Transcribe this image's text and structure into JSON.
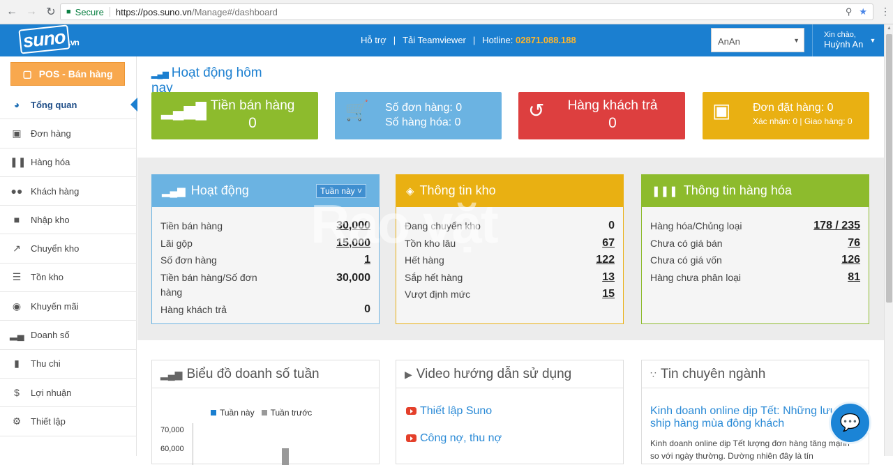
{
  "browser": {
    "secure_label": "Secure",
    "url_host": "https://pos.suno.vn",
    "url_path": "/Manage#/dashboard"
  },
  "header": {
    "logo_main": "suno",
    "logo_suffix": ".vn",
    "support": "Hỗ trợ",
    "teamviewer": "Tải Teamviewer",
    "hotline_label": "Hotline:",
    "hotline_number": "02871.088.188",
    "store": "AnAn",
    "greeting": "Xin chào,",
    "user_name": "Huỳnh An"
  },
  "sidebar": {
    "pos_button": "POS - Bán hàng",
    "items": [
      {
        "label": "Tổng quan",
        "icon": "dashboard-icon"
      },
      {
        "label": "Đơn hàng",
        "icon": "cart-icon"
      },
      {
        "label": "Hàng hóa",
        "icon": "barcode-icon"
      },
      {
        "label": "Khách hàng",
        "icon": "users-icon"
      },
      {
        "label": "Nhập kho",
        "icon": "truck-icon"
      },
      {
        "label": "Chuyển kho",
        "icon": "share-icon"
      },
      {
        "label": "Tồn kho",
        "icon": "list-icon"
      },
      {
        "label": "Khuyến mãi",
        "icon": "gift-icon"
      },
      {
        "label": "Doanh số",
        "icon": "signal-icon"
      },
      {
        "label": "Thu chi",
        "icon": "file-icon"
      },
      {
        "label": "Lợi nhuận",
        "icon": "dollar-icon"
      },
      {
        "label": "Thiết lập",
        "icon": "gears-icon"
      }
    ]
  },
  "main": {
    "title": "Hoạt động hôm nay",
    "cards": {
      "sales_label": "Tiền bán hàng",
      "sales_value": "0",
      "orders_line1": "Số đơn hàng: 0",
      "orders_line2": "Số hàng hóa: 0",
      "returns_label": "Hàng khách trả",
      "returns_value": "0",
      "booking_line1": "Đơn đặt hàng: 0",
      "booking_line2": "Xác nhận: 0 | Giao hàng: 0"
    },
    "activity": {
      "title": "Hoạt động",
      "period": "Tuần này",
      "rows": [
        {
          "label": "Tiền bán hàng",
          "value": "30,000"
        },
        {
          "label": "Lãi gộp",
          "value": "15,000"
        },
        {
          "label": "Số đơn hàng",
          "value": "1"
        },
        {
          "label": "Tiền bán hàng/Số đơn hàng",
          "value": "30,000"
        },
        {
          "label": "Hàng khách trả",
          "value": "0"
        }
      ]
    },
    "warehouse": {
      "title": "Thông tin kho",
      "rows": [
        {
          "label": "Đang chuyển kho",
          "value": "0"
        },
        {
          "label": "Tồn kho lâu",
          "value": "67"
        },
        {
          "label": "Hết hàng",
          "value": "122"
        },
        {
          "label": "Sắp hết hàng",
          "value": "13"
        },
        {
          "label": "Vượt định mức",
          "value": "15"
        }
      ]
    },
    "goods": {
      "title": "Thông tin hàng hóa",
      "rows": [
        {
          "label": "Hàng hóa/Chủng loại",
          "value": "178 / 235"
        },
        {
          "label": "Chưa có giá bán",
          "value": "76"
        },
        {
          "label": "Chưa có giá vốn",
          "value": "126"
        },
        {
          "label": "Hàng chưa phân loại",
          "value": "81"
        }
      ]
    },
    "watermark": "Rao vặt",
    "chart": {
      "title": "Biểu đồ doanh số tuần",
      "legend_this": "Tuần này",
      "legend_prev": "Tuần trước",
      "colors": {
        "this": "#1b7fd0",
        "prev": "#999999"
      },
      "y_ticks": [
        "70,000",
        "60,000"
      ]
    },
    "video": {
      "title": "Video hướng dẫn sử dụng",
      "links": [
        "Thiết lập Suno",
        "Công nợ, thu nợ"
      ]
    },
    "news": {
      "title": "Tin chuyên ngành",
      "headline": "Kinh doanh online dịp Tết: Những lưu ý ship hàng mùa đông khách",
      "excerpt": "Kinh doanh online dịp Tết lượng đơn hàng tăng mạnh so với ngày thường. Dường nhiên đây là tín"
    }
  },
  "colors": {
    "header": "#1b7fd0",
    "green": "#8dbb2d",
    "blue": "#6bb3e2",
    "red": "#dd3f3f",
    "yellow": "#e9b012",
    "orange": "#f8a84e"
  }
}
